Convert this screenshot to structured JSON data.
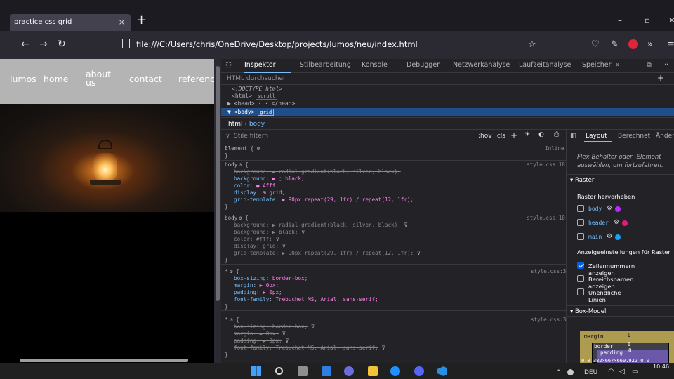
{
  "browser": {
    "tab_title": "practice css grid",
    "tab_close": "×",
    "new_tab": "+",
    "url": "file:///C:/Users/chris/OneDrive/Desktop/projects/lumos/neu/index.html",
    "win_min": "–",
    "win_max": "▫",
    "win_close": "✕"
  },
  "page": {
    "nav": [
      "lumos",
      "home",
      "about us",
      "contact",
      "reference"
    ]
  },
  "devtools": {
    "tabs": [
      "Inspektor",
      "Stilbearbeitung",
      "Konsole",
      "Debugger",
      "Netzwerkanalyse",
      "Laufzeitanalyse",
      "Speicher"
    ],
    "html_search_placeholder": "HTML durchsuchen",
    "tree": {
      "doctype": "<!DOCTYPE html>",
      "html_open": "<html>",
      "html_badge": "scroll",
      "head": "▶ <head> ··· </head>",
      "body": "▼ <body>",
      "body_badge": "grid"
    },
    "breadcrumb": [
      "html",
      "body"
    ],
    "rules_filter_placeholder": "Stile filtern",
    "rules_toolbar": [
      ":hov",
      ".cls",
      "+"
    ],
    "element_rule": "Element {",
    "inline_label": "Inline",
    "rules": [
      {
        "selector": "body",
        "source": "style.css:10",
        "decls": [
          {
            "prop": "background",
            "val": "▶ radial-gradient(black, silver, black);",
            "struck": true
          },
          {
            "prop": "background",
            "val": "▶ ◯ black;",
            "struck": false
          },
          {
            "prop": "color",
            "val": "● #fff;",
            "struck": false
          },
          {
            "prop": "display",
            "val": "⊞ grid;",
            "struck": false
          },
          {
            "prop": "grid-template",
            "val": "▶ 90px repeat(29, 1fr) / repeat(12, 1fr);",
            "struck": false
          }
        ]
      },
      {
        "selector": "body",
        "source": "style.css:10",
        "decls": [
          {
            "prop": "background",
            "val": "▶ radial-gradient(black, silver, black);",
            "struck": true
          },
          {
            "prop": "background",
            "val": "▶ black;",
            "struck": true
          },
          {
            "prop": "color",
            "val": "#fff;",
            "struck": true
          },
          {
            "prop": "display",
            "val": "grid;",
            "struck": true
          },
          {
            "prop": "grid-template",
            "val": "▶ 90px repeat(29, 1fr) / repeat(12, 1fr);",
            "struck": true
          }
        ]
      },
      {
        "selector": "*",
        "source": "style.css:3",
        "decls": [
          {
            "prop": "box-sizing",
            "val": "border-box;",
            "struck": false
          },
          {
            "prop": "margin",
            "val": "▶ 0px;",
            "struck": false
          },
          {
            "prop": "padding",
            "val": "▶ 0px;",
            "struck": false
          },
          {
            "prop": "font-family",
            "val": "Trebuchet MS, Arial, sans-serif;",
            "struck": false
          }
        ]
      },
      {
        "selector": "*",
        "source": "style.css:3",
        "decls": [
          {
            "prop": "box-sizing",
            "val": "border-box;",
            "struck": true
          },
          {
            "prop": "margin",
            "val": "▶ 0px;",
            "struck": true
          },
          {
            "prop": "padding",
            "val": "▶ 0px;",
            "struck": true
          },
          {
            "prop": "font-family",
            "val": "Trebuchet MS, Arial, sans-serif;",
            "struck": true
          }
        ]
      }
    ],
    "layout_panel": {
      "tabs": [
        "Layout",
        "Berechnet",
        "Änder"
      ],
      "flexbox_hint": "Flex-Behälter oder -Element auswählen, um fortzufahren.",
      "raster_title": "Raster",
      "highlight_title": "Raster hervorheben",
      "grids": [
        {
          "name": "body",
          "color": "#b72aff"
        },
        {
          "name": "header",
          "color": "#e8177a"
        },
        {
          "name": "main",
          "color": "#1aa0f5"
        }
      ],
      "settings_title": "Anzeigeeinstellungen für Raster",
      "settings": [
        {
          "label": "Zeilennummern anzeigen",
          "checked": true
        },
        {
          "label": "Bereichsnamen anzeigen",
          "checked": false
        },
        {
          "label": "Unendliche Linien",
          "checked": false
        }
      ],
      "boxmodel_title": "Box-Modell",
      "bm_margin": "margin",
      "bm_border": "border",
      "bm_padding": "padding",
      "bm_zero": "0",
      "bm_content": "0 0 382×667×660.922 0 0"
    }
  },
  "taskbar": {
    "lang": "DEU",
    "time": "10:46"
  }
}
